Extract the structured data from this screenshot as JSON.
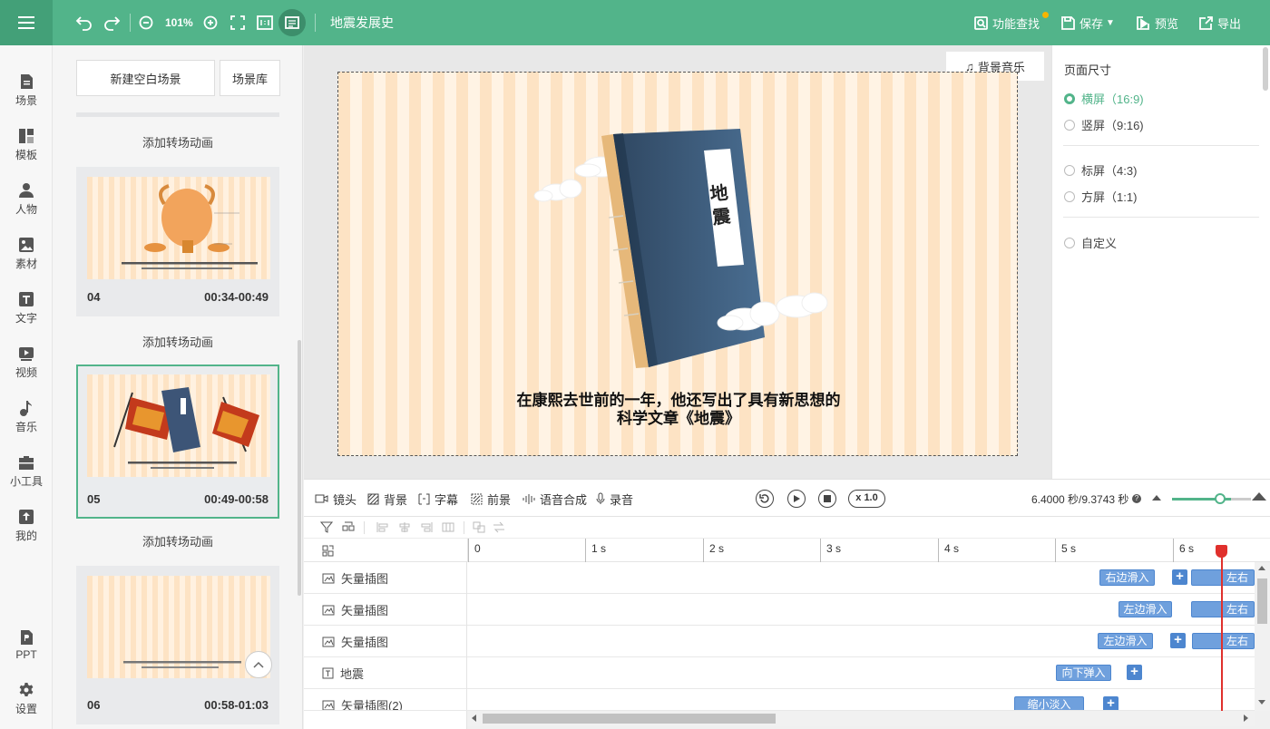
{
  "topbar": {
    "zoom": "101%",
    "title": "地震发展史",
    "find_label": "功能查找",
    "save_label": "保存",
    "preview_label": "预览",
    "export_label": "导出",
    "accent": "#52b48a"
  },
  "leftnav": {
    "items": [
      {
        "label": "场景",
        "icon": "scene-icon"
      },
      {
        "label": "模板",
        "icon": "template-icon"
      },
      {
        "label": "人物",
        "icon": "person-icon"
      },
      {
        "label": "素材",
        "icon": "material-icon"
      },
      {
        "label": "文字",
        "icon": "text-icon"
      },
      {
        "label": "视频",
        "icon": "video-icon"
      },
      {
        "label": "音乐",
        "icon": "music-icon"
      },
      {
        "label": "小工具",
        "icon": "toolbox-icon"
      },
      {
        "label": "我的",
        "icon": "upload-icon"
      },
      {
        "label": "PPT",
        "icon": "ppt-icon"
      },
      {
        "label": "设置",
        "icon": "gear-icon"
      }
    ]
  },
  "scenes": {
    "new_blank": "新建空白场景",
    "library": "场景库",
    "transition_label": "添加转场动画",
    "cards": [
      {
        "num": "04",
        "time": "00:34-00:49"
      },
      {
        "num": "05",
        "time": "00:49-00:58"
      },
      {
        "num": "06",
        "time": "00:58-01:03"
      }
    ]
  },
  "stage": {
    "bg_music": "背景音乐",
    "book_title": "地震",
    "caption_line1": "在康熙去世前的一年，他还写出了具有新思想的",
    "caption_line2": "科学文章《地震》"
  },
  "page_size": {
    "title": "页面尺寸",
    "options": [
      "横屏（16:9)",
      "竖屏（9:16)",
      "标屏（4:3)",
      "方屏（1:1)",
      "自定义"
    ],
    "selected": "横屏（16:9)"
  },
  "timeline": {
    "tools": [
      "镜头",
      "背景",
      "字幕",
      "前景",
      "语音合成",
      "录音"
    ],
    "speed": "x 1.0",
    "time_readout": "6.4000 秒/9.3743 秒",
    "ruler": [
      "0",
      "1 s",
      "2 s",
      "3 s",
      "4 s",
      "5 s",
      "6 s"
    ],
    "tracks": [
      {
        "label": "矢量插图",
        "anims": [
          "右边滑入",
          "左右"
        ]
      },
      {
        "label": "矢量插图",
        "anims": [
          "左边滑入",
          "左右"
        ]
      },
      {
        "label": "矢量插图",
        "anims": [
          "左边滑入",
          "左右"
        ]
      },
      {
        "label": "地震",
        "anims": [
          "向下弹入"
        ]
      },
      {
        "label": "矢量插图(2)",
        "anims": [
          "缩小淡入"
        ]
      }
    ]
  }
}
